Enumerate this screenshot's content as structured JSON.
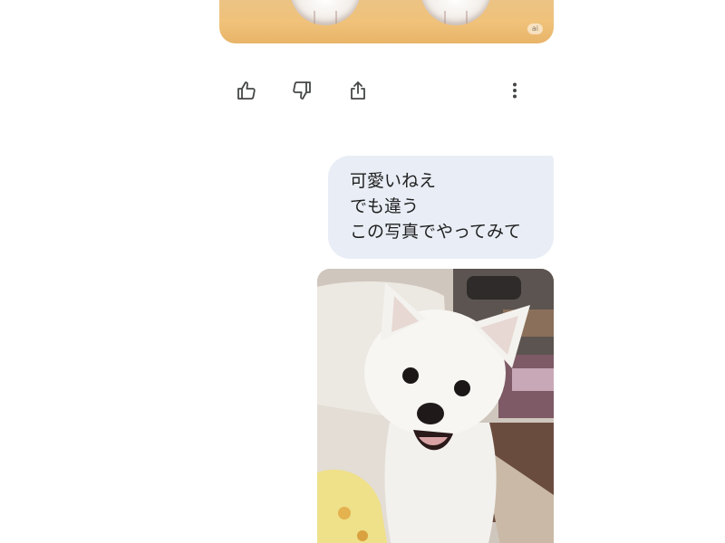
{
  "ai_image": {
    "badge": "ai"
  },
  "actions": {
    "thumbs_up": "thumbs-up-icon",
    "thumbs_down": "thumbs-down-icon",
    "share": "share-icon",
    "more": "more-vert-icon"
  },
  "user_message": {
    "lines": [
      "可愛いねえ",
      "でも違う",
      "この写真でやってみて"
    ]
  },
  "colors": {
    "bubble_bg": "#e9eef6",
    "icon": "#444746",
    "text": "#1f1f1f"
  }
}
